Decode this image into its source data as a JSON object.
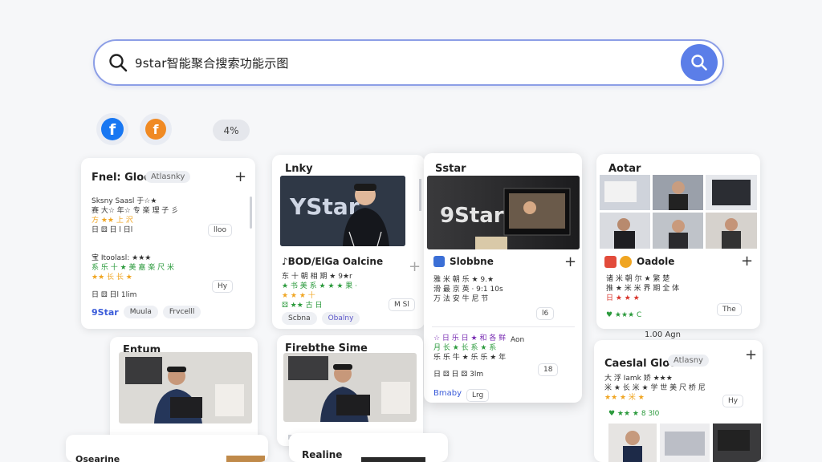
{
  "search": {
    "query": "9star智能聚合搜索功能示图",
    "search_button": "search"
  },
  "sources": {
    "facebook": "f",
    "orange": "f",
    "count_pill": "4%"
  },
  "cards": {
    "c1": {
      "title": "Fnel: Gloo",
      "tag": "Atlasnky",
      "lines": [
        "Sksny Saasl 于☆★",
        "赛 大☆ 年☆ 专 楽 理 子 彡",
        "方 ★★ 上 沢",
        "日 ⚄ 日 l 日l"
      ],
      "btn1": "lloo",
      "lines2": [
        "宝 Itoolasl: ★★★",
        "系 乐 十 ★ 美 嘉 楽 尺 米",
        "★★ 长 长 ★"
      ],
      "btn2": "Hy",
      "lines3": [
        "日 ⚄ 日l 1lim"
      ],
      "footer": [
        "9Star",
        "Muula",
        "Frvcelll"
      ]
    },
    "c2": {
      "title": "Lnky",
      "img_text": "YStar",
      "subtitle": "♪BOD/ElGa Oalcine",
      "lines": [
        "东 十 朝 相 期 ★ 9★r",
        "★ 书 美 系 ★ ★ ★ 果 ·",
        "★ ★ ★ 十",
        "⚄ ★★ 古 日"
      ],
      "btn": "M  Sl",
      "footer": [
        "Scbna",
        "Obalny"
      ]
    },
    "c3": {
      "title": "Sstar",
      "img_text": "9Star",
      "subtitle": "Slobbne",
      "lines": [
        "雅 米 朝 乐 ★ 9.★",
        "滑 最 京 英  ·  9:1 10s",
        "万 法 安 牛 尼 节"
      ],
      "btn1": "l6",
      "lines2": [
        "☆ 日 乐 日 ★ 和 各 鲜",
        "月 长 ★ 长 系 ★ 系",
        "乐 乐 牛 ★ 乐 乐 ★ 年"
      ],
      "tag2": "Aon",
      "lines3": [
        "日 ⚄ 日 ⚄ 3lm"
      ],
      "btn2": "18",
      "footer": [
        "Bmaby",
        "Lrg"
      ]
    },
    "c4": {
      "title": "Aotar",
      "subtitle": "Oadole",
      "lines": [
        "诸 米 朝 尔 ★ 繁 楚",
        "推 ★ 米 米 界 期 全 体",
        "日 ★ ★ ★"
      ],
      "btn1": "The",
      "lines2": [
        "♥ ★★★ C"
      ],
      "stat": "1.00 Agn"
    },
    "c5": {
      "title": "Entum"
    },
    "c6": {
      "title": "Firebthe Sime"
    },
    "c7": {
      "title": "Caeslal Gloer",
      "tag": "Atlasny",
      "lines": [
        "大 浮 Iamk 娇 ★★★",
        "米 ★ 长 米 ★ 学 世 美 尺 桥 尼",
        "★★ ★ 米 ★"
      ],
      "btn": "Hy",
      "lines2": [
        "♥ ★★ ★ 8 3l0"
      ]
    },
    "c8": {
      "title": "Osearine"
    },
    "c9": {
      "title": "Realine"
    }
  }
}
